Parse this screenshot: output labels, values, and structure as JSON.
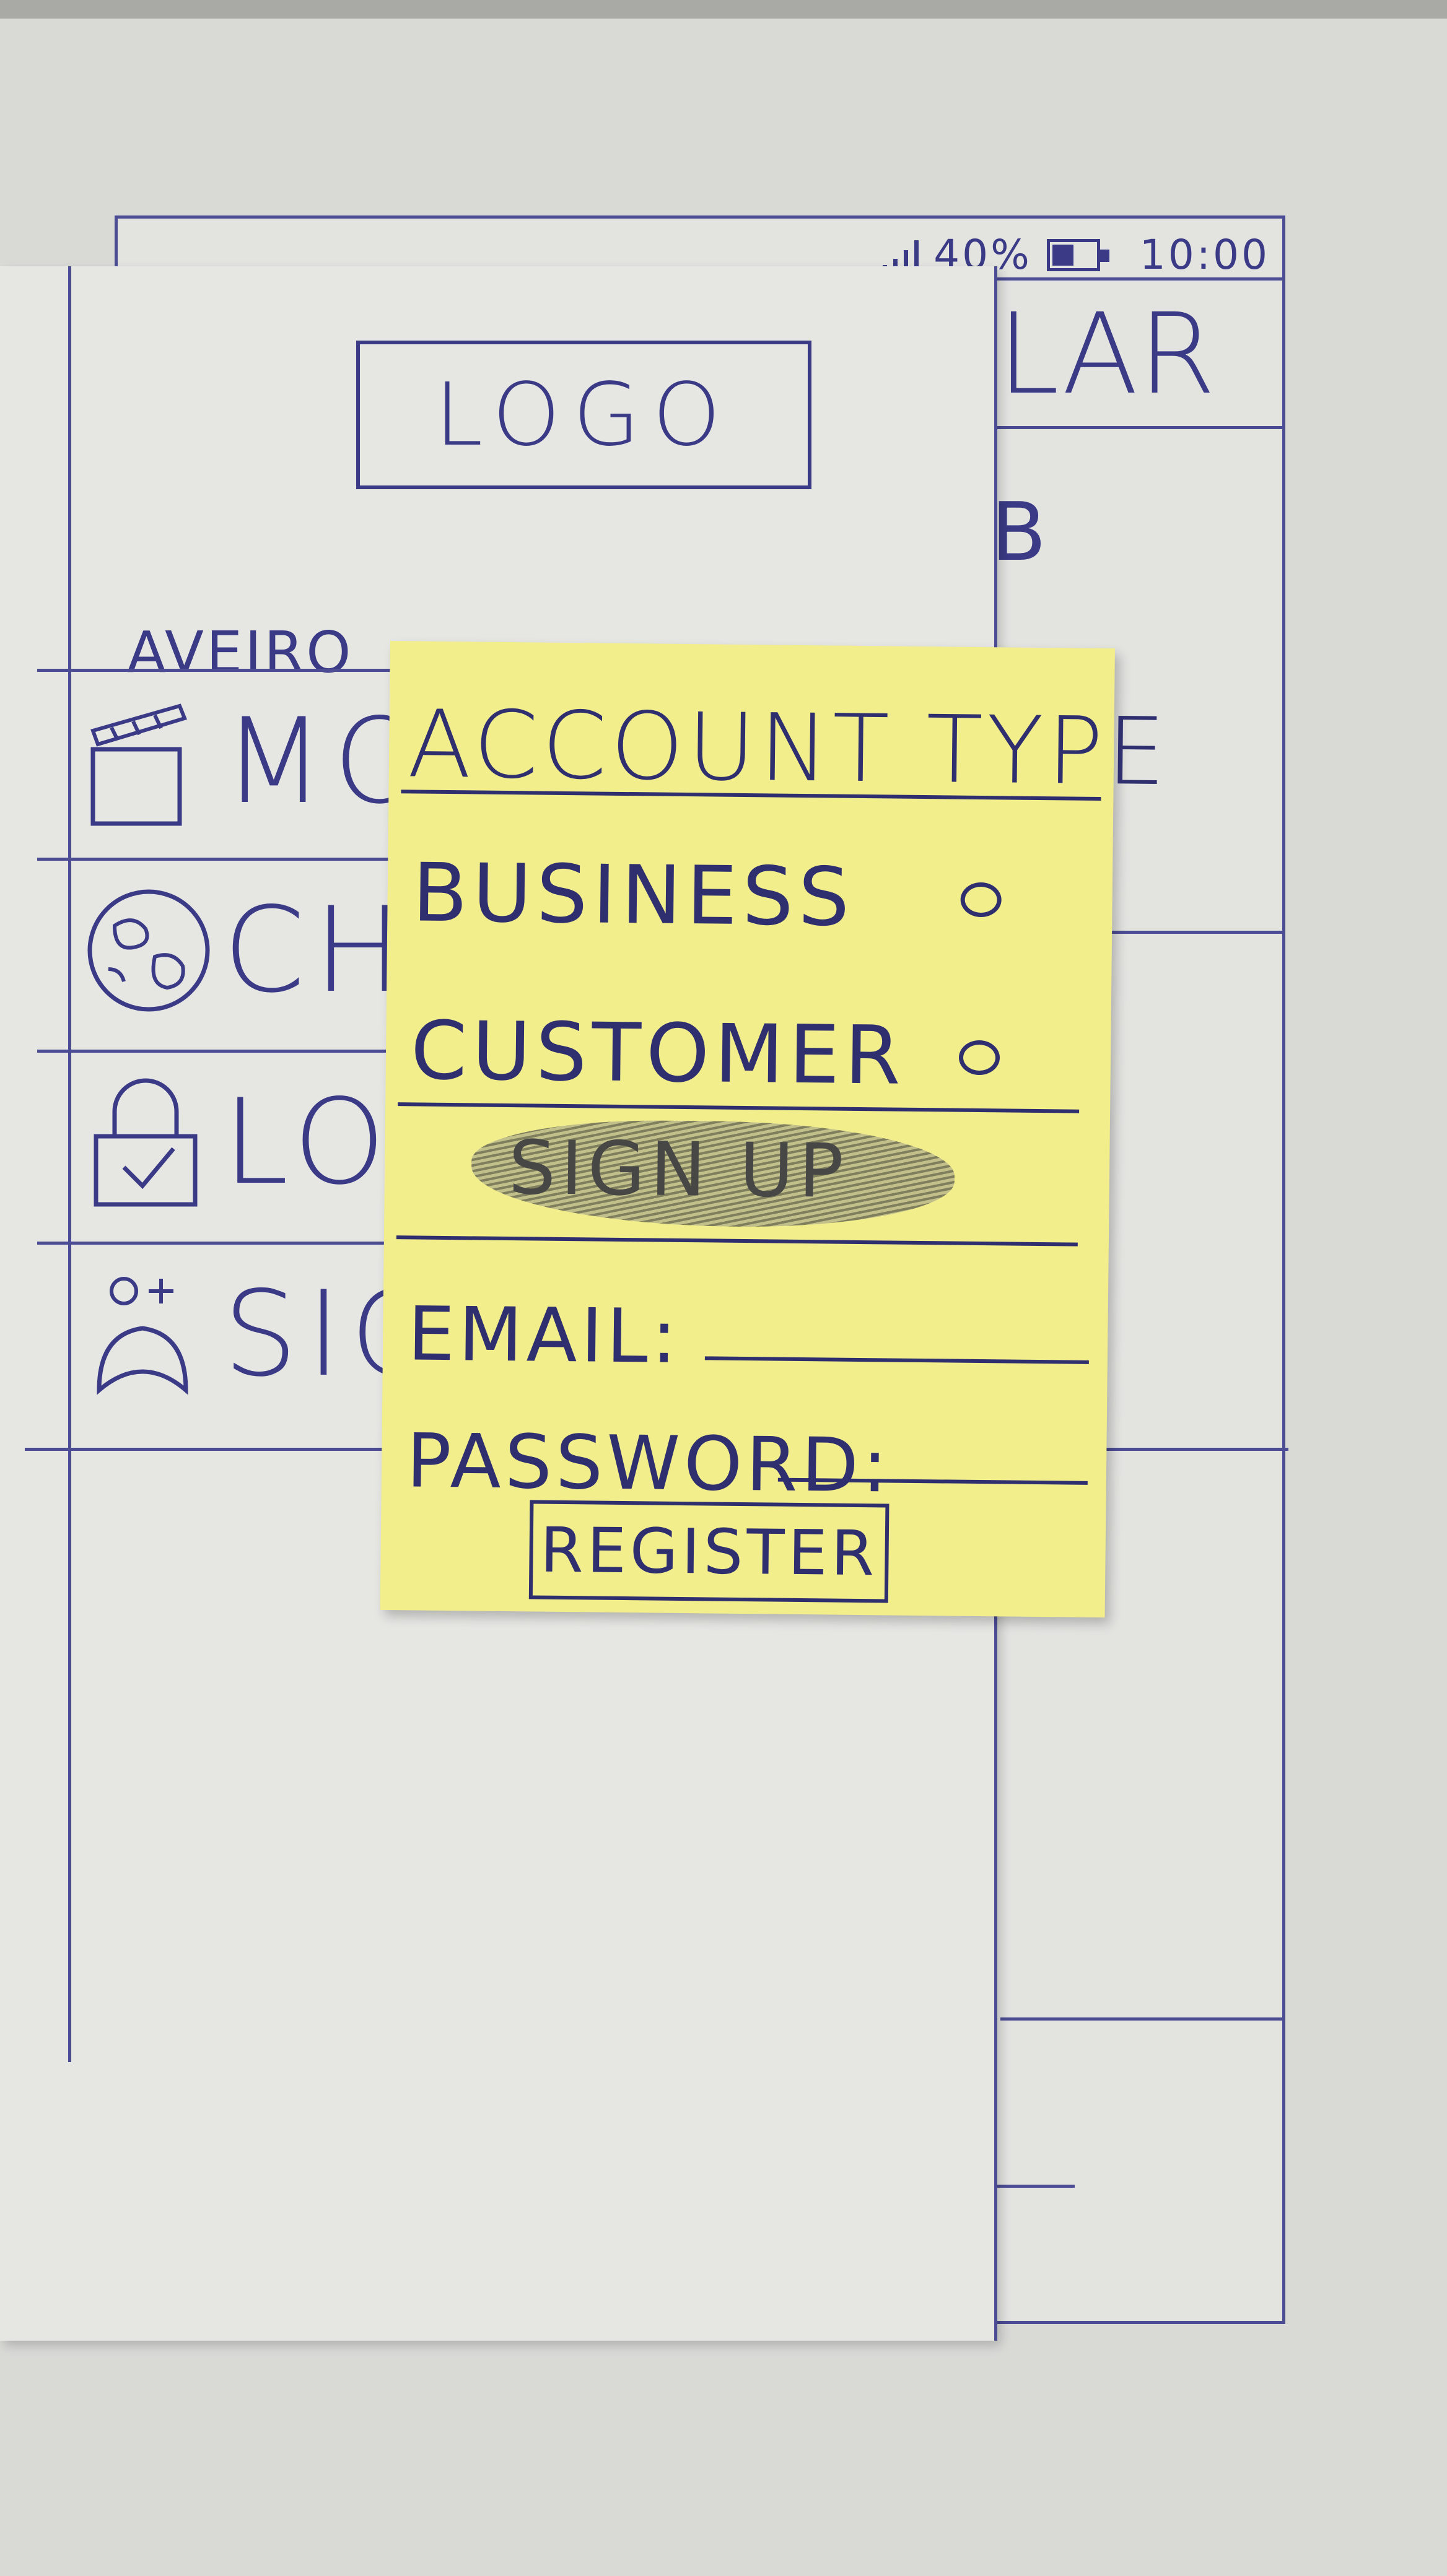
{
  "status_bar": {
    "battery": "40%",
    "time": "10:00"
  },
  "background_screen": {
    "header_partial": "LAR",
    "row_partial": "B"
  },
  "drawer": {
    "logo": "LOGO",
    "location": "AVEIRO",
    "menu": [
      {
        "label": "MOV",
        "icon": "clapperboard-icon"
      },
      {
        "label": "CHAN",
        "icon": "globe-icon"
      },
      {
        "label": "LOG",
        "icon": "padlock-icon"
      },
      {
        "label": "SIG",
        "icon": "add-user-icon"
      }
    ]
  },
  "dialog": {
    "title": "ACCOUNT TYPE",
    "options": [
      {
        "label": "BUSINESS",
        "selected": false
      },
      {
        "label": "CUSTOMER",
        "selected": false
      }
    ],
    "crossed_out": "SIGN UP",
    "email_label": "EMAIL:",
    "password_label": "PASSWORD:",
    "register_label": "REGISTER"
  }
}
